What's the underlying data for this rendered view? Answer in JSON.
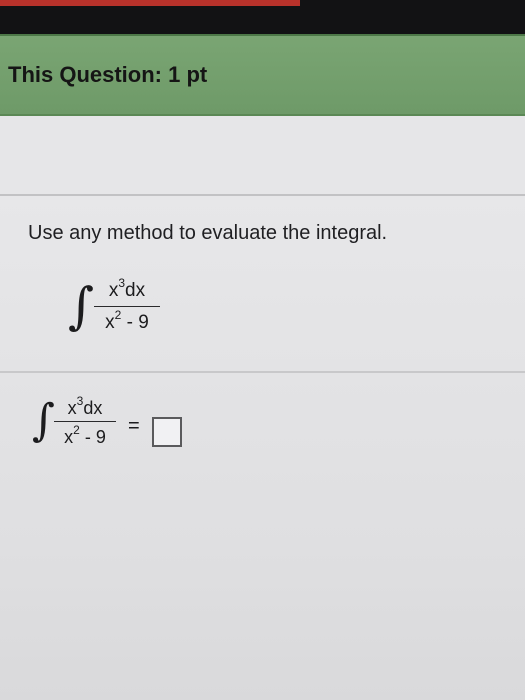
{
  "header": {
    "question_points": "This Question: 1 pt"
  },
  "question": {
    "instruction": "Use any method to evaluate the integral.",
    "integral_sign": "∫",
    "numerator_base": "x",
    "numerator_exponent": "3",
    "numerator_tail": "dx",
    "denominator_base": "x",
    "denominator_exponent": "2",
    "denominator_tail": " - 9"
  },
  "answer": {
    "equals": "=",
    "value": ""
  },
  "colors": {
    "header_green": "#7aa573",
    "top_bar": "#121214",
    "page_background": "#e2e2e4"
  }
}
